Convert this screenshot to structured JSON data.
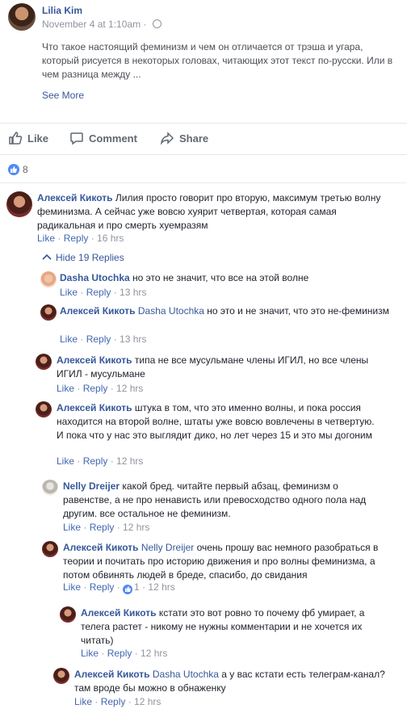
{
  "post": {
    "author": "Lilia Kim",
    "timestamp": "November 4 at 1:10am",
    "separator": "·",
    "text": "Что такое настоящий феминизм и чем он отличается от трэша и угара, который рисуется в некоторых головах, читающих этот текст по-русски. Или в чем разница между ...",
    "see_more": "See More"
  },
  "actions": {
    "like": "Like",
    "comment": "Comment",
    "share": "Share"
  },
  "reactions": {
    "count": "8"
  },
  "replies_toggle": "Hide 19 Replies",
  "comments": [
    {
      "name": "Алексей Кикоть",
      "mention": "",
      "text": "Лилия просто говорит про вторую, максимум третью волну феминизма. А сейчас уже вовсю хуярит четвертая, которая самая радикальная и про смерть хуемразям",
      "like": "Like",
      "reply": "Reply",
      "time": "16 hrs"
    },
    {
      "name": "Dasha Utochka",
      "mention": "",
      "text": "но это не значит, что все на этой волне",
      "like": "Like",
      "reply": "Reply",
      "time": "13 hrs"
    },
    {
      "name": "Алексей Кикоть",
      "mention": "Dasha Utochka",
      "text": "но это и не значит, что это не-феминизм",
      "like": "Like",
      "reply": "Reply",
      "time": "13 hrs"
    },
    {
      "name": "Алексей Кикоть",
      "mention": "",
      "text": "типа не все мусульмане члены ИГИЛ, но все члены ИГИЛ - мусульмане",
      "like": "Like",
      "reply": "Reply",
      "time": "12 hrs"
    },
    {
      "name": "Алексей Кикоть",
      "mention": "",
      "text": "штука в том, что это именно волны, и пока россия находится на второй волне, штаты уже вовсю вовлечены в четвертую. И пока что у нас это выглядит дико, но лет через 15 и это мы догоним",
      "like": "Like",
      "reply": "Reply",
      "time": "12 hrs"
    },
    {
      "name": "Nelly Dreijer",
      "mention": "",
      "text": "какой бред. читайте первый абзац, феминизм о равенстве, а не про ненависть или превосходство одного пола над другим. все остальное не феминизм.",
      "like": "Like",
      "reply": "Reply",
      "time": "12 hrs"
    },
    {
      "name": "Алексей Кикоть",
      "mention": "Nelly Dreijer",
      "text": "очень прошу вас немного разобраться в теории и почитать про историю движения и про волны феминизма, а потом обвинять людей в бреде, спасибо, до свидания",
      "like": "Like",
      "reply": "Reply",
      "likes": "1",
      "time": "12 hrs"
    },
    {
      "name": "Алексей Кикоть",
      "mention": "",
      "text": "кстати это вот ровно то почему фб умирает, а телега растет - никому не нужны комментарии и не хочется их читать)",
      "like": "Like",
      "reply": "Reply",
      "time": "12 hrs"
    },
    {
      "name": "Алексей Кикоть",
      "mention": "Dasha Utochka",
      "text": "а у вас кстати есть телеграм-канал? там вроде бы можно в обнаженку",
      "like": "Like",
      "reply": "Reply",
      "time": "12 hrs"
    }
  ],
  "colors": {
    "link": "#365899",
    "meta": "#90949c",
    "like_blue": "#4f8af5"
  }
}
